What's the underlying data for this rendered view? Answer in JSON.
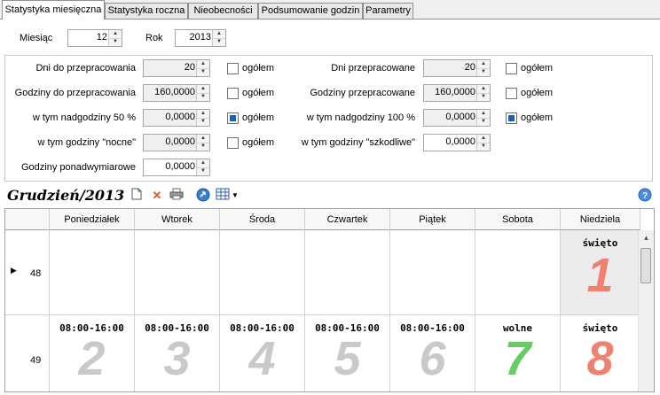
{
  "tabs": [
    "Statystyka miesięczna",
    "Statystyka roczna",
    "Nieobecności",
    "Podsumowanie godzin",
    "Parametry"
  ],
  "period": {
    "month_label": "Miesiąc",
    "month_value": "12",
    "year_label": "Rok",
    "year_value": "2013"
  },
  "fields": {
    "days_to_work": {
      "label": "Dni do przepracowania",
      "value": "20",
      "check": "ogółem"
    },
    "days_worked": {
      "label": "Dni przepracowane",
      "value": "20",
      "check": "ogółem"
    },
    "hours_to_work": {
      "label": "Godziny do przepracowania",
      "value": "160,0000",
      "check": "ogółem"
    },
    "hours_worked": {
      "label": "Godziny przepracowane",
      "value": "160,0000",
      "check": "ogółem"
    },
    "overtime50": {
      "label": "w tym nadgodziny 50 %",
      "value": "0,0000",
      "check": "ogółem",
      "checked": true
    },
    "overtime100": {
      "label": "w tym nadgodziny 100 %",
      "value": "0,0000",
      "check": "ogółem",
      "checked": true
    },
    "night_hours": {
      "label": "w tym godziny \"nocne\"",
      "value": "0,0000",
      "check": "ogółem"
    },
    "harmful_hours": {
      "label": "w tym godziny \"szkodliwe\"",
      "value": "0,0000"
    },
    "extra_hours": {
      "label": "Godziny ponadwymiarowe",
      "value": "0,0000"
    }
  },
  "calendar": {
    "title": "Grudzień/2013",
    "days": [
      "Poniedziałek",
      "Wtorek",
      "Środa",
      "Czwartek",
      "Piątek",
      "Sobota",
      "Niedziela"
    ],
    "rows": [
      {
        "week": "48",
        "cells": [
          {
            "top": "",
            "num": ""
          },
          {
            "top": "",
            "num": ""
          },
          {
            "top": "",
            "num": ""
          },
          {
            "top": "",
            "num": ""
          },
          {
            "top": "",
            "num": ""
          },
          {
            "top": "",
            "num": ""
          },
          {
            "top": "święto",
            "num": "1"
          }
        ]
      },
      {
        "week": "49",
        "cells": [
          {
            "top": "08:00-16:00",
            "num": "2"
          },
          {
            "top": "08:00-16:00",
            "num": "3"
          },
          {
            "top": "08:00-16:00",
            "num": "4"
          },
          {
            "top": "08:00-16:00",
            "num": "5"
          },
          {
            "top": "08:00-16:00",
            "num": "6"
          },
          {
            "top": "wolne",
            "num": "7"
          },
          {
            "top": "święto",
            "num": "8"
          }
        ]
      }
    ]
  },
  "colors": {
    "workday": "#c9c9c9",
    "saturday": "#66cc66",
    "holiday": "#f08070",
    "accent": "#1c5fb5"
  },
  "toolbar_icons": [
    "new-document-icon",
    "delete-icon",
    "print-icon",
    "refresh-icon",
    "grid-icon",
    "dropdown-icon",
    "help-icon"
  ]
}
